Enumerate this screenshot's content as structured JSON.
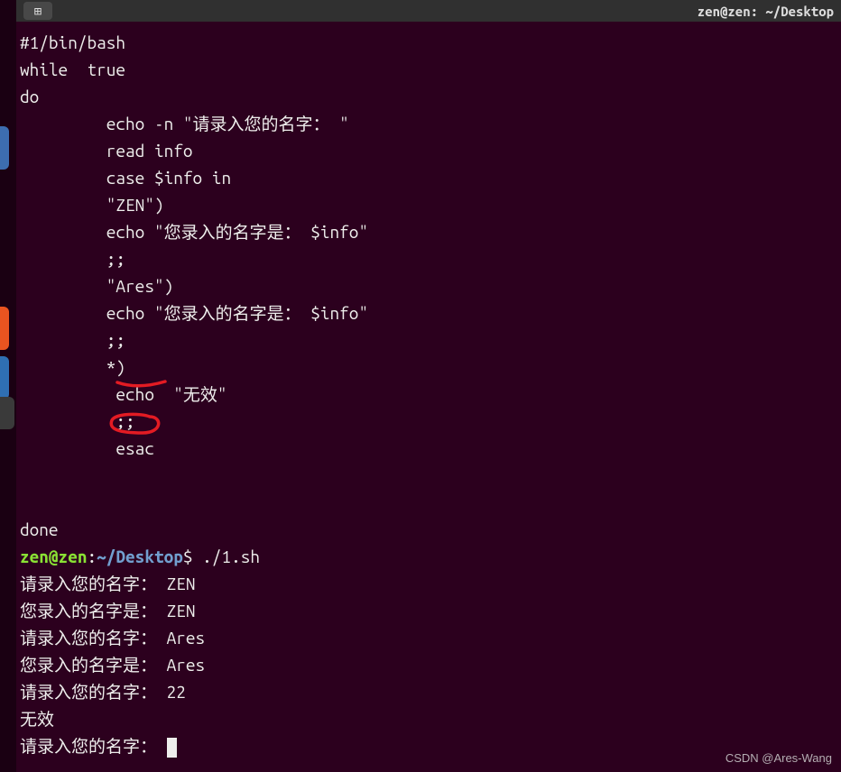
{
  "topbar": {
    "btn_label": "⊞",
    "title_right": "zen@zen: ~/Desktop"
  },
  "script": {
    "l1": "#1/bin/bash",
    "l2": "while  true",
    "l3": "do",
    "l4": "         echo -n \"请录入您的名字： \"",
    "l5": "         read info",
    "l6": "         case $info in",
    "l7": "         \"ZEN\")",
    "l8": "         echo \"您录入的名字是： $info\"",
    "l9": "         ;;",
    "l10": "         \"Ares\")",
    "l11": "         echo \"您录入的名字是： $info\"",
    "l12": "         ;;",
    "l13": "         *)",
    "l14": "          echo  \"无效\"",
    "l15": "          ;;",
    "l16": "          esac",
    "l17": "",
    "l18": "",
    "l19": "done"
  },
  "prompt": {
    "user": "zen@zen",
    "colon": ":",
    "path": "~/Desktop",
    "dollar": "$ ",
    "cmd": "./1.sh"
  },
  "output": {
    "o1": "请录入您的名字： ZEN",
    "o2": "您录入的名字是： ZEN",
    "o3": "请录入您的名字： Ares",
    "o4": "您录入的名字是： Ares",
    "o5": "请录入您的名字： 22",
    "o6": "无效",
    "o7": "请录入您的名字： "
  },
  "watermark": "CSDN @Ares-Wang",
  "colors": {
    "sidebar_icon1": "#3d6db0",
    "sidebar_icon2": "#e95420",
    "sidebar_icon3": "#2f6fb3"
  }
}
